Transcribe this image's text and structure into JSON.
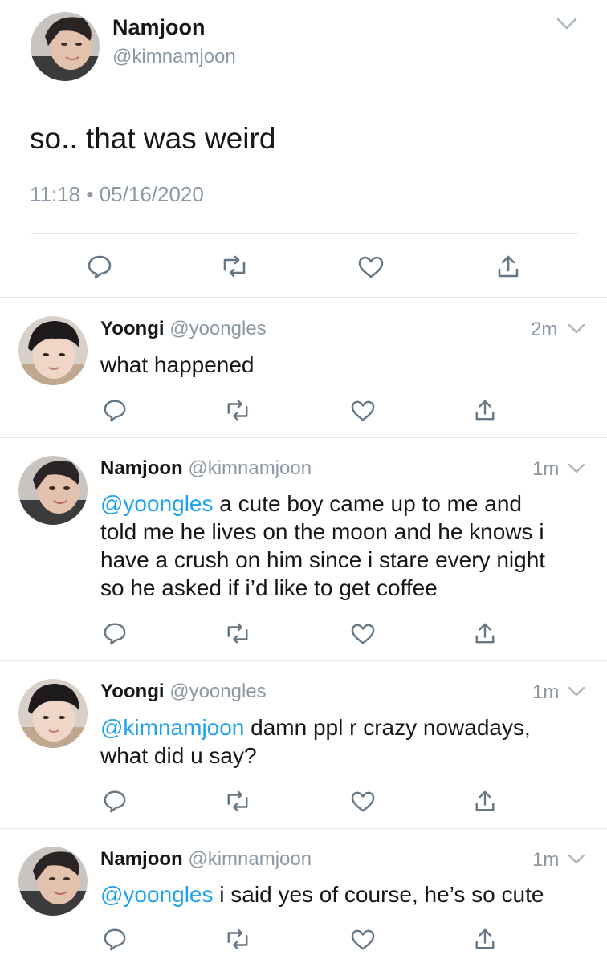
{
  "main_tweet": {
    "name": "Namjoon",
    "handle": "@kimnamjoon",
    "text": "so.. that was weird",
    "time": "11:18",
    "separator": "•",
    "date": "05/16/2020",
    "avatar_icon": "avatar-namjoon",
    "menu_icon": "chevron-down-icon"
  },
  "action_icons": [
    "reply-icon",
    "retweet-icon",
    "like-icon",
    "share-icon"
  ],
  "replies": [
    {
      "name": "Yoongi",
      "handle": "@yoongles",
      "time": "2m",
      "mention": "",
      "lines": [
        "what happened"
      ]
    },
    {
      "name": "Namjoon",
      "handle": "@kimnamjoon",
      "time": "1m",
      "mention": "@yoongles",
      "lines": [
        " a cute boy came up to me and",
        "told me he lives on the moon and he knows i",
        "have a crush on him since i stare every night",
        "so he asked if i’d like to get coffee"
      ]
    },
    {
      "name": "Yoongi",
      "handle": "@yoongles",
      "time": "1m",
      "mention": "@kimnamjoon",
      "lines": [
        " damn ppl r crazy nowadays,",
        "what did u say?"
      ]
    },
    {
      "name": "Namjoon",
      "handle": "@kimnamjoon",
      "time": "1m",
      "mention": "@yoongles",
      "lines": [
        " i said yes of course, he’s so cute"
      ]
    }
  ],
  "colors": {
    "mention": "#1da1f2",
    "muted": "#8b98a5",
    "divider": "#e1e8ed",
    "text": "#14171a"
  }
}
